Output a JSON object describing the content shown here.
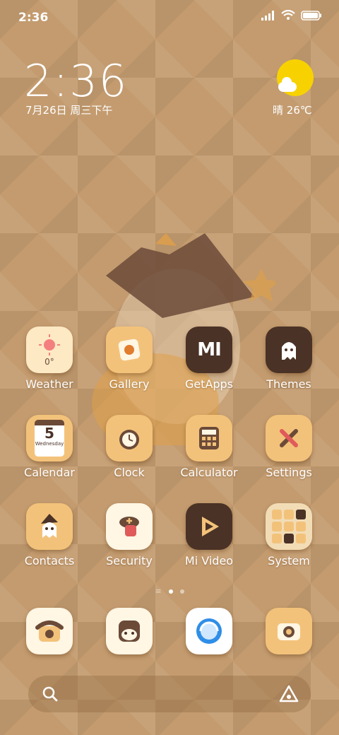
{
  "status": {
    "time": "2:36"
  },
  "clock": {
    "time": "2:36",
    "date": "7月26日 周三下午"
  },
  "weather": {
    "condition": "晴",
    "temp": "26℃"
  },
  "apps": [
    {
      "label": "Weather",
      "icon": "sun-icon",
      "value": "0°"
    },
    {
      "label": "Gallery",
      "icon": "gallery-icon"
    },
    {
      "label": "GetApps",
      "icon": "mi-icon",
      "value": "MI"
    },
    {
      "label": "Themes",
      "icon": "ghost-icon"
    },
    {
      "label": "Calendar",
      "icon": "calendar-icon",
      "value": "5",
      "sub": "Wednesday"
    },
    {
      "label": "Clock",
      "icon": "alarm-clock-icon"
    },
    {
      "label": "Calculator",
      "icon": "calculator-icon"
    },
    {
      "label": "Settings",
      "icon": "tools-icon"
    },
    {
      "label": "Contacts",
      "icon": "ghost-witch-icon"
    },
    {
      "label": "Security",
      "icon": "shield-icon"
    },
    {
      "label": "Mi Video",
      "icon": "play-icon"
    },
    {
      "label": "System",
      "icon": "folder-icon"
    }
  ],
  "dock": [
    {
      "name": "phone",
      "icon": "telephone-icon"
    },
    {
      "name": "messages",
      "icon": "cat-chat-icon"
    },
    {
      "name": "browser",
      "icon": "browser-icon"
    },
    {
      "name": "camera",
      "icon": "camera-icon"
    }
  ],
  "colors": {
    "background": "#c39b6f",
    "sun": "#f7d200",
    "iconBg": "#f3c27a",
    "dark": "#4a3226"
  }
}
